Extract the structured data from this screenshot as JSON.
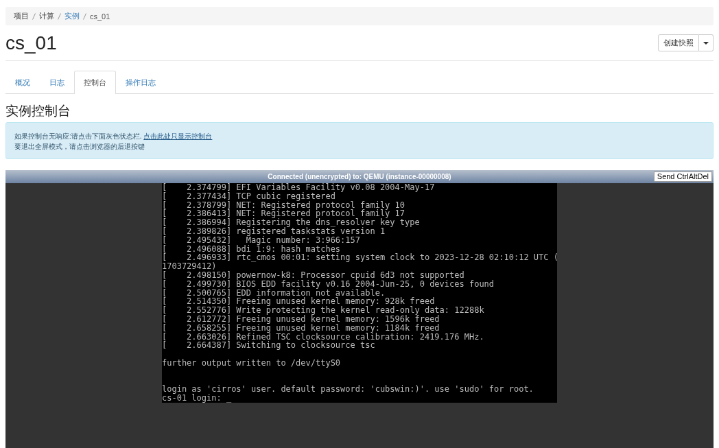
{
  "breadcrumb": [
    {
      "label": "项目",
      "link": false
    },
    {
      "label": "计算",
      "link": false
    },
    {
      "label": "实例",
      "link": true
    },
    {
      "label": "cs_01",
      "link": false
    }
  ],
  "title": "cs_01",
  "actions": {
    "primary": "创建快照"
  },
  "tabs": [
    {
      "label": "概况",
      "selected": false
    },
    {
      "label": "日志",
      "selected": false
    },
    {
      "label": "控制台",
      "selected": true
    },
    {
      "label": "操作日志",
      "selected": false
    }
  ],
  "section_title": "实例控制台",
  "alert": {
    "line1": "如果控制台无响应:请点击下面灰色状态栏.",
    "link": "点击此处只显示控制台",
    "line2": "要退出全屏模式，请点击浏览器的后退按键"
  },
  "console": {
    "status": "Connected (unencrypted) to: QEMU (instance-00000008)",
    "button": "Send CtrlAltDel",
    "sections": [
      {
        "kind": "log",
        "lines": [
          "[    2.374799] EFI Variables Facility v0.08 2004-May-17",
          "[    2.377434] TCP cubic registered",
          "[    2.378799] NET: Registered protocol family 10",
          "[    2.386413] NET: Registered protocol family 17",
          "[    2.386994] Registering the dns_resolver key type",
          "[    2.389826] registered taskstats version 1",
          "[    2.495432]   Magic number: 3:966:157",
          "[    2.496088] bdi 1:9: hash matches",
          "[    2.496933] rtc_cmos 00:01: setting system clock to 2023-12-28 02:10:12 UTC (",
          "1703729412)",
          "[    2.498150] powernow-k8: Processor cpuid 6d3 not supported",
          "[    2.499730] BIOS EDD facility v0.16 2004-Jun-25, 0 devices found",
          "[    2.500765] EDD information not available.",
          "[    2.514350] Freeing unused kernel memory: 928k freed",
          "[    2.552776] Write protecting the kernel read-only data: 12288k",
          "[    2.612772] Freeing unused kernel memory: 1596k freed",
          "[    2.658255] Freeing unused kernel memory: 1184k freed",
          "[    2.663026] Refined TSC clocksource calibration: 2419.176 MHz.",
          "[    2.664387] Switching to clocksource tsc"
        ]
      },
      {
        "kind": "message",
        "lines": [
          "further output written to /dev/ttyS0"
        ]
      },
      {
        "kind": "prompt",
        "lines": [
          "login as 'cirros' user. default password: 'cubswin:)'. use 'sudo' for root.",
          "cs-01 login: _"
        ]
      }
    ]
  }
}
